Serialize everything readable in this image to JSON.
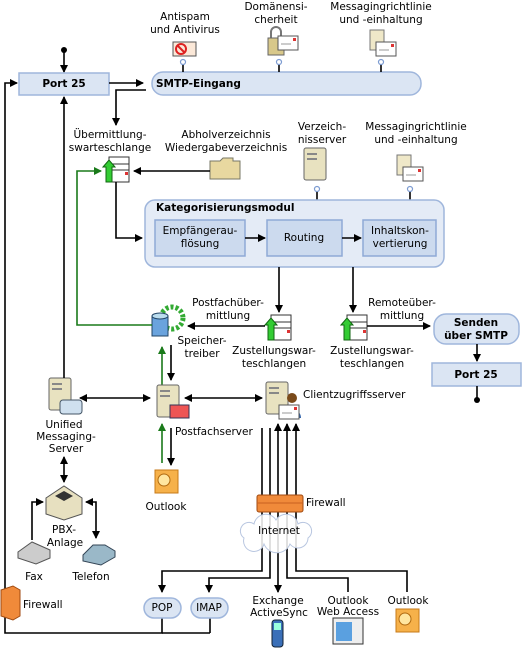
{
  "smtp_in": {
    "port": "Port 25",
    "title": "SMTP-Eingang"
  },
  "agents_top": {
    "antispam": [
      "Antispam",
      "und Antivirus"
    ],
    "domain_security": [
      "Domänensi-",
      "cherheit"
    ],
    "policy": [
      "Messagingrichtlinie",
      "und -einhaltung"
    ]
  },
  "submission_queue": [
    "Übermittlung-",
    "swarteschlange"
  ],
  "pickup": [
    "Abholverzeichnis",
    "Wiedergabeverzeichnis"
  ],
  "directory_server": [
    "Verzeich-",
    "nisserver"
  ],
  "policy2": [
    "Messagingrichtlinie",
    "und -einhaltung"
  ],
  "categorizer": {
    "title": "Kategorisierungsmodul",
    "recipient": [
      "Empfängerau-",
      "flösung"
    ],
    "routing": "Routing",
    "content": [
      "Inhaltskon-",
      "vertierung"
    ]
  },
  "mailbox_delivery": [
    "Postfachüber-",
    "mittlung"
  ],
  "remote_delivery": [
    "Remoteüber-",
    "mittlung"
  ],
  "delivery_queue1": [
    "Zustellungswar-",
    "teschlangen"
  ],
  "delivery_queue2": [
    "Zustellungswar-",
    "teschlangen"
  ],
  "store_driver": [
    "Speicher-",
    "treiber"
  ],
  "send_smtp": {
    "title": [
      "Senden",
      "über SMTP"
    ],
    "port": "Port 25"
  },
  "servers": {
    "um": [
      "Unified",
      "Messaging-",
      "Server"
    ],
    "mailbox": "Postfachserver",
    "cas": "Clientzugriffsserver"
  },
  "pbx": [
    "PBX-",
    "Anlage"
  ],
  "fax": "Fax",
  "phone": "Telefon",
  "outlook_local": "Outlook",
  "firewall_left": "Firewall",
  "firewall_mid": "Firewall",
  "internet": "Internet",
  "clients": {
    "pop": "POP",
    "imap": "IMAP",
    "eas": [
      "Exchange",
      "ActiveSync"
    ],
    "owa": [
      "Outlook",
      "Web Access"
    ],
    "outlook": "Outlook"
  },
  "colors": {
    "box": "#dbe5f3",
    "border": "#9fb6dc",
    "green": "#1a7a1a"
  }
}
